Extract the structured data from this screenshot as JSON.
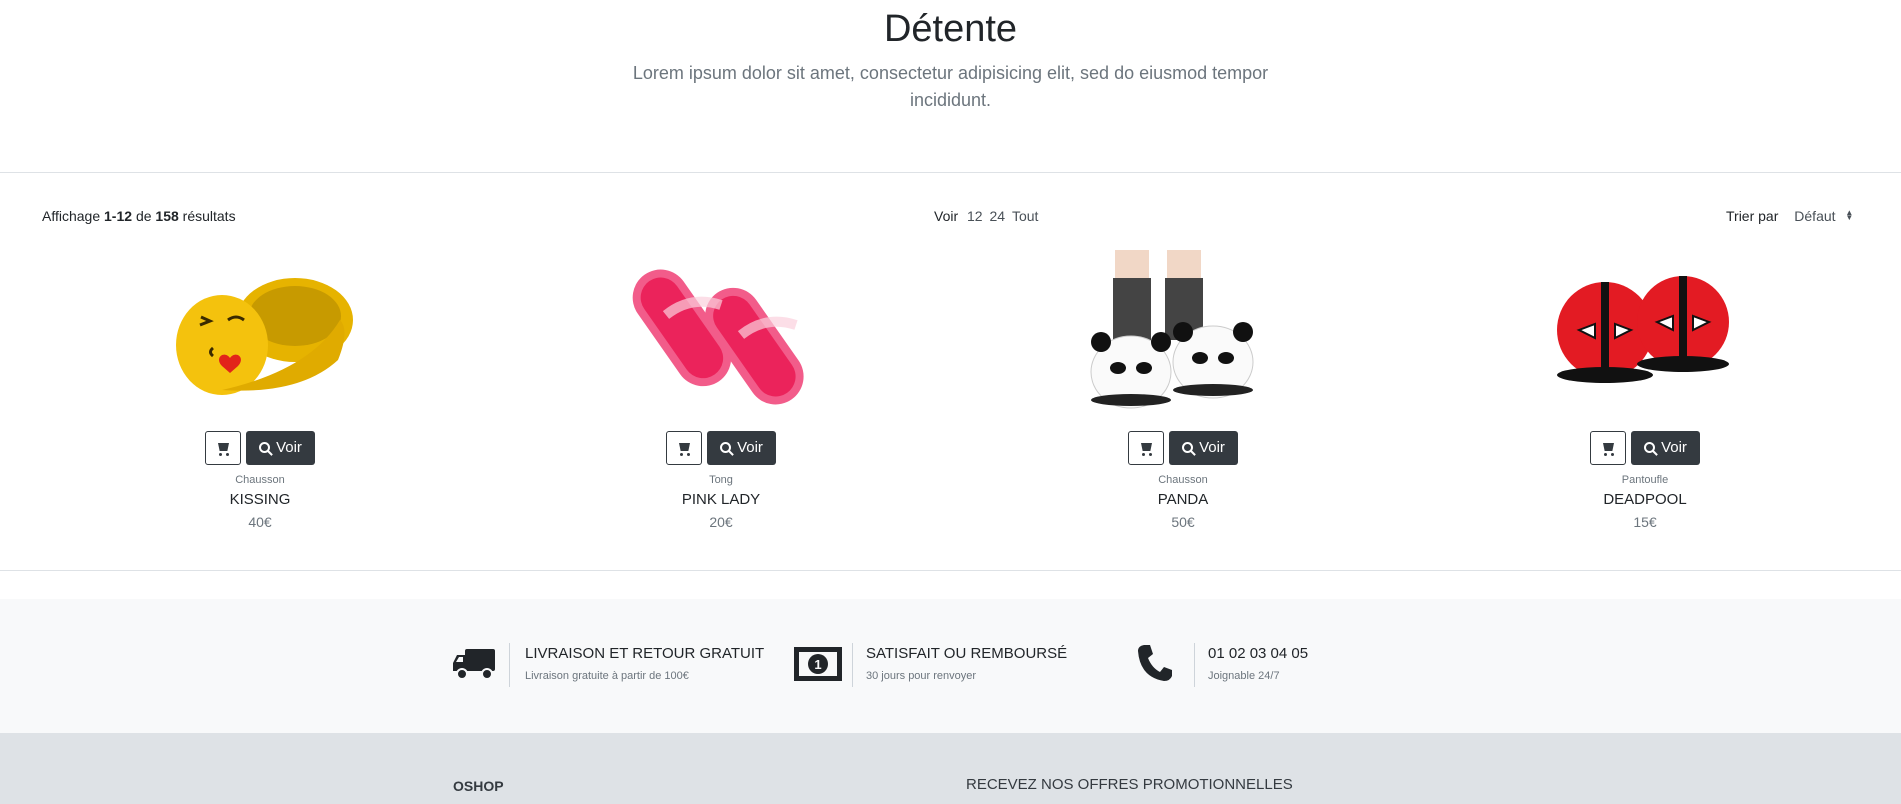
{
  "hero": {
    "title": "Détente",
    "subtitle": "Lorem ipsum dolor sit amet, consectetur adipisicing elit, sed do eiusmod tempor incididunt."
  },
  "toolbar": {
    "results_prefix": "Affichage",
    "results_range": "1-12",
    "results_of": "de",
    "results_total": "158",
    "results_suffix": "résultats",
    "per_page_label": "Voir",
    "per_page_options": [
      "12",
      "24",
      "Tout"
    ],
    "sort_label": "Trier par",
    "sort_value": "Défaut"
  },
  "products": [
    {
      "category": "Chausson",
      "name": "KISSING",
      "price": "40€",
      "view_label": "Voir",
      "image": "emoji-kiss-slipper"
    },
    {
      "category": "Tong",
      "name": "PINK LADY",
      "price": "20€",
      "view_label": "Voir",
      "image": "pink-jelly-sandals"
    },
    {
      "category": "Chausson",
      "name": "PANDA",
      "price": "50€",
      "view_label": "Voir",
      "image": "panda-slippers"
    },
    {
      "category": "Pantoufle",
      "name": "DEADPOOL",
      "price": "15€",
      "view_label": "Voir",
      "image": "deadpool-slippers"
    }
  ],
  "features": [
    {
      "icon": "truck-icon",
      "title": "LIVRAISON ET RETOUR GRATUIT",
      "subtitle": "Livraison gratuite à partir de 100€"
    },
    {
      "icon": "money-icon",
      "title": "SATISFAIT OU REMBOURSÉ",
      "subtitle": "30 jours pour renvoyer"
    },
    {
      "icon": "phone-icon",
      "title": "01 02 03 04 05",
      "subtitle": "Joignable 24/7"
    }
  ],
  "footer": {
    "brand": "OSHOP",
    "promo_heading": "RECEVEZ NOS OFFRES PROMOTIONNELLES"
  }
}
